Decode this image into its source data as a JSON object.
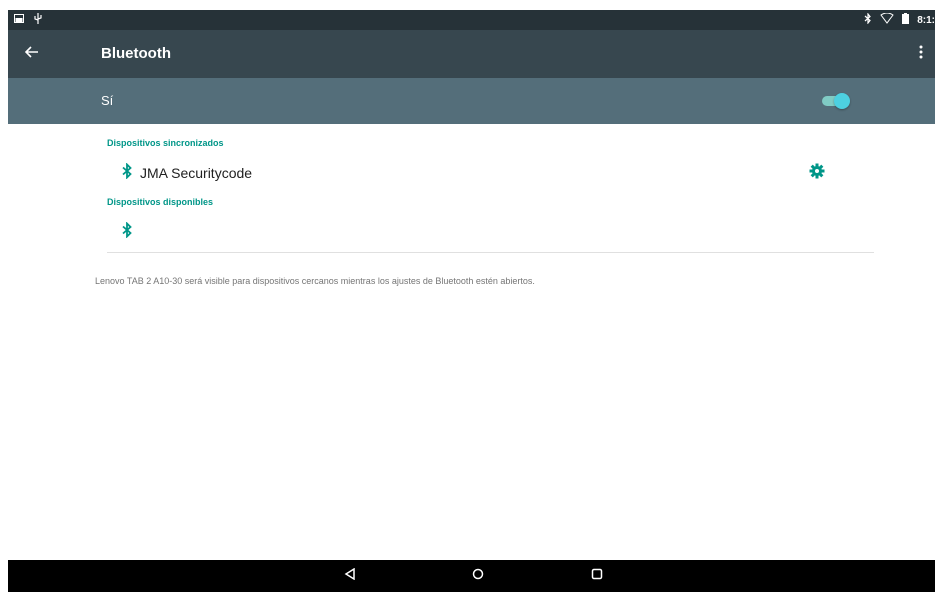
{
  "status_bar": {
    "left_icons": [
      "image-icon",
      "usb-icon"
    ],
    "right_icons": [
      "bluetooth-icon",
      "wifi-icon",
      "battery-icon"
    ],
    "time": "8:1:"
  },
  "toolbar": {
    "back_icon": "arrow-back-icon",
    "title": "Bluetooth",
    "menu_icon": "more-vert-icon"
  },
  "master_switch": {
    "label": "Sí",
    "state": "on",
    "accent": "#4dd0e1"
  },
  "sections": {
    "paired_header": "Dispositivos sincronizados",
    "paired_devices": [
      {
        "name": "JMA Securitycode",
        "icon": "bluetooth-icon",
        "action_icon": "gear-icon"
      }
    ],
    "available_header": "Dispositivos disponibles",
    "available_devices": [
      {
        "name": "",
        "icon": "bluetooth-icon"
      }
    ]
  },
  "footer": {
    "visibility_text": "Lenovo TAB 2 A10-30 será visible para dispositivos cercanos mientras los ajustes de Bluetooth estén abiertos."
  },
  "nav_bar": {
    "buttons": [
      "back-triangle-icon",
      "home-circle-icon",
      "recents-square-icon"
    ]
  },
  "colors": {
    "status_bar": "#263238",
    "toolbar": "#37474f",
    "switch_bar": "#546e7a",
    "accent": "#009688"
  }
}
